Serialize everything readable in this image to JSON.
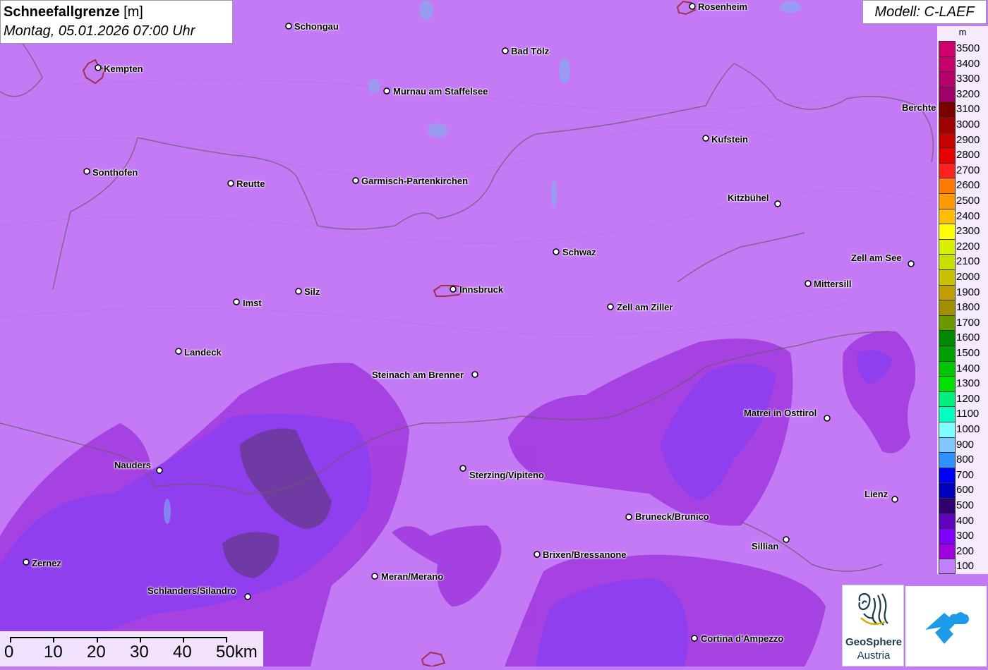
{
  "title": {
    "main_bold": "Schneefallgrenze",
    "main_unit": " [m]",
    "subtitle": "Montag, 05.01.2026 07:00 Uhr"
  },
  "model_label": "Modell: C-LAEF",
  "legend": {
    "unit": "m",
    "entries": [
      {
        "label": "3500",
        "color": "#d0006e"
      },
      {
        "label": "3400",
        "color": "#c8006e"
      },
      {
        "label": "3300",
        "color": "#b8006c"
      },
      {
        "label": "3200",
        "color": "#a0006a"
      },
      {
        "label": "3100",
        "color": "#7a0000"
      },
      {
        "label": "3000",
        "color": "#a00000"
      },
      {
        "label": "2900",
        "color": "#c80000"
      },
      {
        "label": "2800",
        "color": "#e60000"
      },
      {
        "label": "2700",
        "color": "#ff2020"
      },
      {
        "label": "2600",
        "color": "#ff7a00"
      },
      {
        "label": "2500",
        "color": "#ff9a00"
      },
      {
        "label": "2400",
        "color": "#ffbe00"
      },
      {
        "label": "2300",
        "color": "#ffff00"
      },
      {
        "label": "2200",
        "color": "#d8f000"
      },
      {
        "label": "2100",
        "color": "#c8e000"
      },
      {
        "label": "2000",
        "color": "#c8c000"
      },
      {
        "label": "1900",
        "color": "#c0a000"
      },
      {
        "label": "1800",
        "color": "#a09000"
      },
      {
        "label": "1700",
        "color": "#6a9a00"
      },
      {
        "label": "1600",
        "color": "#008800"
      },
      {
        "label": "1500",
        "color": "#00a000"
      },
      {
        "label": "1400",
        "color": "#00c800"
      },
      {
        "label": "1300",
        "color": "#00e000"
      },
      {
        "label": "1200",
        "color": "#00f080"
      },
      {
        "label": "1100",
        "color": "#00ffc0"
      },
      {
        "label": "1000",
        "color": "#80ffff"
      },
      {
        "label": "900",
        "color": "#80c8ff"
      },
      {
        "label": "800",
        "color": "#3090ff"
      },
      {
        "label": "700",
        "color": "#0000ff"
      },
      {
        "label": "600",
        "color": "#0000c0"
      },
      {
        "label": "500",
        "color": "#300070"
      },
      {
        "label": "400",
        "color": "#6000c0"
      },
      {
        "label": "300",
        "color": "#8000ff"
      },
      {
        "label": "200",
        "color": "#a000e0"
      },
      {
        "label": "100",
        "color": "#c080ff"
      }
    ]
  },
  "cities": [
    {
      "name": "Rosenheim"
    },
    {
      "name": "Schongau"
    },
    {
      "name": "Kempten"
    },
    {
      "name": "Bad Tölz"
    },
    {
      "name": "Murnau am Staffelsee"
    },
    {
      "name": "Berchte"
    },
    {
      "name": "Kufstein"
    },
    {
      "name": "Sonthofen"
    },
    {
      "name": "Reutte"
    },
    {
      "name": "Garmisch-Partenkirchen"
    },
    {
      "name": "Kitzbühel"
    },
    {
      "name": "Schwaz"
    },
    {
      "name": "Zell am See"
    },
    {
      "name": "Mittersill"
    },
    {
      "name": "Silz"
    },
    {
      "name": "Innsbruck"
    },
    {
      "name": "Imst"
    },
    {
      "name": "Zell am Ziller"
    },
    {
      "name": "Landeck"
    },
    {
      "name": "Steinach am Brenner"
    },
    {
      "name": "Matrei in Osttirol"
    },
    {
      "name": "Nauders"
    },
    {
      "name": "Sterzing/Vipiteno"
    },
    {
      "name": "Lienz"
    },
    {
      "name": "Bruneck/Brunico"
    },
    {
      "name": "Sillian"
    },
    {
      "name": "Brixen/Bressanone"
    },
    {
      "name": "Zernez"
    },
    {
      "name": "Meran/Merano"
    },
    {
      "name": "Schlanders/Silandro"
    },
    {
      "name": "Cortina d'Ampezzo"
    }
  ],
  "scale": {
    "labels": [
      "0",
      "10",
      "20",
      "30",
      "40",
      "50km"
    ]
  },
  "logo": {
    "line1": "GeoSphere",
    "line2": "Austria"
  }
}
